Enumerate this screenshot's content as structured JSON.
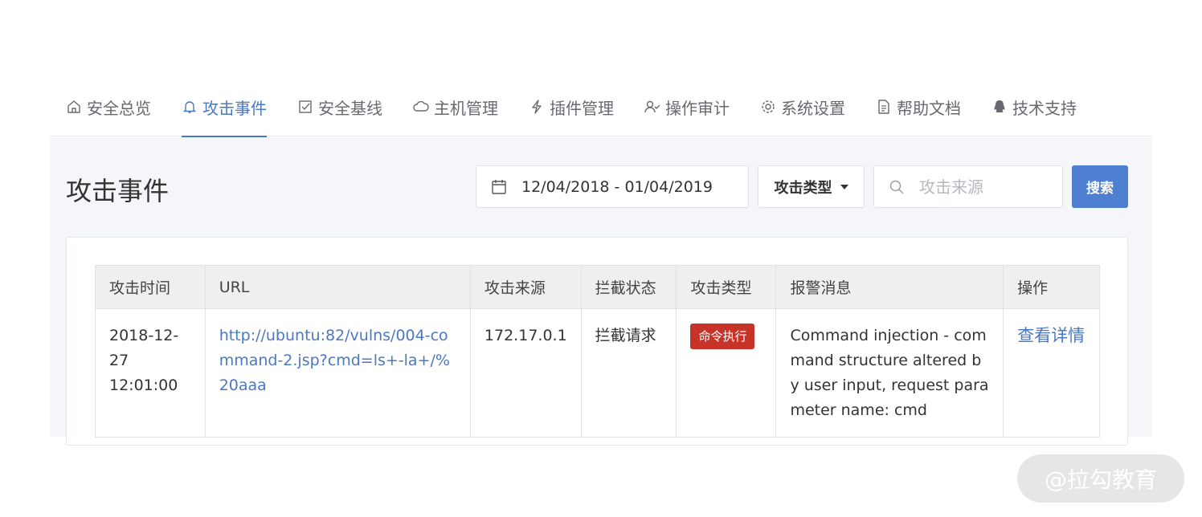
{
  "nav": {
    "items": [
      {
        "label": "安全总览",
        "icon": "home-icon"
      },
      {
        "label": "攻击事件",
        "icon": "bell-icon",
        "active": true
      },
      {
        "label": "安全基线",
        "icon": "checkbox-icon"
      },
      {
        "label": "主机管理",
        "icon": "cloud-icon"
      },
      {
        "label": "插件管理",
        "icon": "lightning-icon"
      },
      {
        "label": "操作审计",
        "icon": "user-check-icon"
      },
      {
        "label": "系统设置",
        "icon": "gear-icon"
      },
      {
        "label": "帮助文档",
        "icon": "document-icon"
      },
      {
        "label": "技术支持",
        "icon": "qq-icon"
      }
    ],
    "active_color": "#4a78c2"
  },
  "page": {
    "title": "攻击事件"
  },
  "filters": {
    "date_range": "12/04/2018 - 01/04/2019",
    "type_dropdown": "攻击类型",
    "source_placeholder": "攻击来源",
    "search_button": "搜索"
  },
  "table": {
    "headers": [
      "攻击时间",
      "URL",
      "攻击来源",
      "拦截状态",
      "攻击类型",
      "报警消息",
      "操作"
    ],
    "rows": [
      {
        "date": "2018-12-27",
        "time": "12:01:00",
        "url": "http://ubuntu:82/vulns/004-command-2.jsp?cmd=ls+-la+/%20aaa",
        "source": "172.17.0.1",
        "status": "拦截请求",
        "type": "命令执行",
        "message": "Command injection - command structure altered by user input, request parameter name: cmd",
        "action": "查看详情"
      }
    ]
  },
  "colors": {
    "primary": "#4e7fd0",
    "badge_danger": "#c83329"
  },
  "watermark": "@拉勾教育"
}
